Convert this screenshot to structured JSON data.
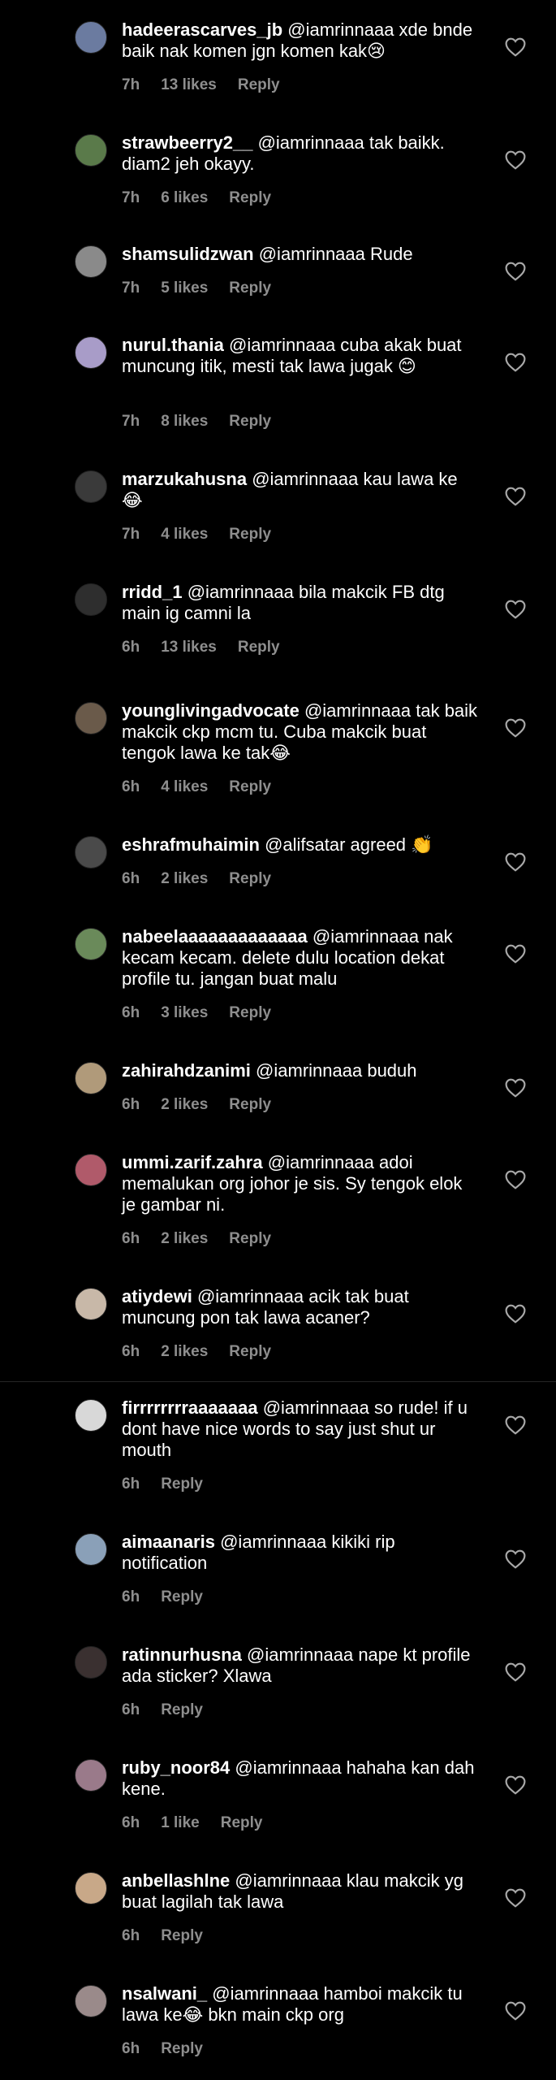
{
  "comments": [
    {
      "username": "hadeerascarves_jb",
      "text": "@iamrinnaaa xde bnde baik nak komen jgn komen kak😢",
      "time": "7h",
      "likes": "13 likes",
      "reply": "Reply",
      "avatar_color": "#6b7ba0"
    },
    {
      "username": "strawbeerry2__",
      "text": "@iamrinnaaa tak baikk. diam2 jeh okayy.",
      "time": "7h",
      "likes": "6 likes",
      "reply": "Reply",
      "avatar_color": "#5a7a4a"
    },
    {
      "username": "shamsulidzwan",
      "text": "@iamrinnaaa Rude",
      "time": "7h",
      "likes": "5 likes",
      "reply": "Reply",
      "avatar_color": "#8a8a8a"
    },
    {
      "username": "nurul.thania",
      "text": "@iamrinnaaa cuba akak buat muncung itik, mesti tak lawa jugak 😊",
      "time": "7h",
      "likes": "8 likes",
      "reply": "Reply",
      "avatar_color": "#a89cc8"
    },
    {
      "username": "marzukahusna",
      "text": "@iamrinnaaa kau lawa ke 😂",
      "time": "7h",
      "likes": "4 likes",
      "reply": "Reply",
      "avatar_color": "#3a3a3a"
    },
    {
      "username": "rridd_1",
      "text": "@iamrinnaaa bila makcik FB dtg main ig camni la",
      "time": "6h",
      "likes": "13 likes",
      "reply": "Reply",
      "avatar_color": "#2e2e2e"
    },
    {
      "username": "younglivingadvocate",
      "text": "@iamrinnaaa tak baik makcik ckp mcm tu. Cuba makcik buat tengok lawa ke tak😂",
      "time": "6h",
      "likes": "4 likes",
      "reply": "Reply",
      "avatar_color": "#6a5a4a"
    },
    {
      "username": "eshrafmuhaimin",
      "text": "@alifsatar agreed 👏",
      "time": "6h",
      "likes": "2 likes",
      "reply": "Reply",
      "avatar_color": "#4a4a4a"
    },
    {
      "username": "nabeelaaaaaaaaaaaaa",
      "text": "@iamrinnaaa nak kecam kecam. delete dulu location dekat profile tu. jangan buat malu",
      "time": "6h",
      "likes": "3 likes",
      "reply": "Reply",
      "avatar_color": "#6a8a5a"
    },
    {
      "username": "zahirahdzanimi",
      "text": "@iamrinnaaa buduh",
      "time": "6h",
      "likes": "2 likes",
      "reply": "Reply",
      "avatar_color": "#b09a7a"
    },
    {
      "username": "ummi.zarif.zahra",
      "text": "@iamrinnaaa adoi memalukan org johor je sis. Sy tengok elok je gambar ni.",
      "time": "6h",
      "likes": "2 likes",
      "reply": "Reply",
      "avatar_color": "#b05a6a"
    },
    {
      "username": "atiydewi",
      "text": "@iamrinnaaa acik tak buat muncung pon tak lawa acaner?",
      "time": "6h",
      "likes": "2 likes",
      "reply": "Reply",
      "avatar_color": "#c8b8a8"
    },
    {
      "username": "firrrrrrrraaaaaaa",
      "text": "@iamrinnaaa so rude! if u dont have nice words to say just shut ur mouth",
      "time": "6h",
      "likes": "",
      "reply": "Reply",
      "avatar_color": "#d8d8d8"
    },
    {
      "username": "aimaanaris",
      "text": "@iamrinnaaa kikiki rip notification",
      "time": "6h",
      "likes": "",
      "reply": "Reply",
      "avatar_color": "#8aa0b8"
    },
    {
      "username": "ratinnurhusna",
      "text": "@iamrinnaaa nape kt profile ada sticker? Xlawa",
      "time": "6h",
      "likes": "",
      "reply": "Reply",
      "avatar_color": "#3a3030"
    },
    {
      "username": "ruby_noor84",
      "text": "@iamrinnaaa hahaha kan dah kene.",
      "time": "6h",
      "likes": "1 like",
      "reply": "Reply",
      "avatar_color": "#9a7a8a"
    },
    {
      "username": "anbellashlne",
      "text": "@iamrinnaaa klau makcik yg buat lagilah tak lawa",
      "time": "6h",
      "likes": "",
      "reply": "Reply",
      "avatar_color": "#c8a888"
    },
    {
      "username": "nsalwani_",
      "text": "@iamrinnaaa hamboi makcik tu lawa ke😂 bkn main ckp org",
      "time": "6h",
      "likes": "",
      "reply": "Reply",
      "avatar_color": "#9a8a8a"
    }
  ],
  "icons": {
    "like": "heart-outline-icon"
  }
}
